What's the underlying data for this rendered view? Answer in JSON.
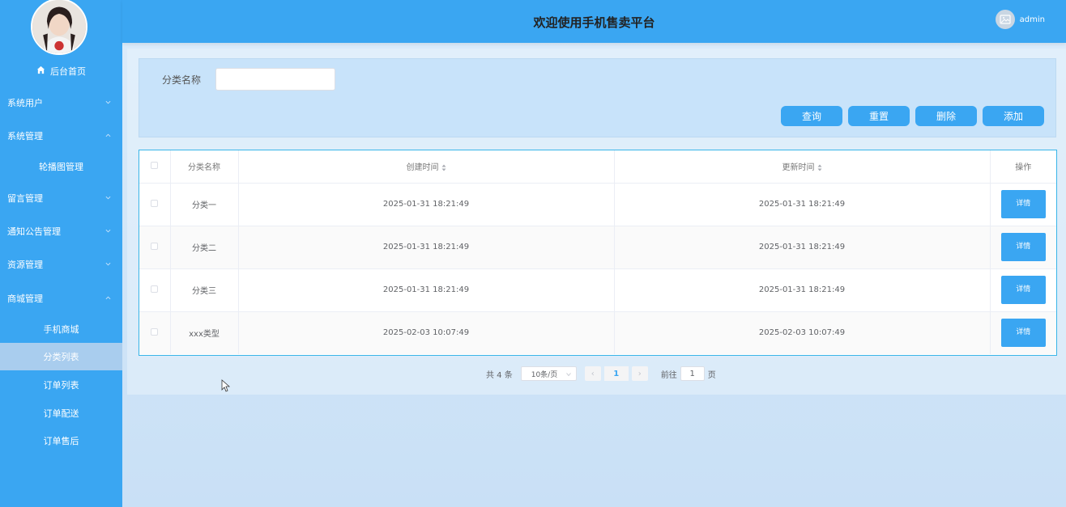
{
  "header": {
    "title": "欢迎使用手机售卖平台",
    "user": "admin"
  },
  "sidebar": {
    "home": "后台首页",
    "groups": [
      {
        "label": "系统用户",
        "expanded": false
      },
      {
        "label": "系统管理",
        "expanded": true,
        "items": [
          "轮播图管理"
        ]
      },
      {
        "label": "留言管理",
        "expanded": false
      },
      {
        "label": "通知公告管理",
        "expanded": false
      },
      {
        "label": "资源管理",
        "expanded": false
      },
      {
        "label": "商城管理",
        "expanded": true,
        "items": [
          "手机商城",
          "分类列表",
          "订单列表",
          "订单配送",
          "订单售后"
        ]
      }
    ],
    "active": "分类列表"
  },
  "search": {
    "label": "分类名称",
    "value": "",
    "buttons": {
      "query": "查询",
      "reset": "重置",
      "delete": "删除",
      "add": "添加"
    }
  },
  "table": {
    "columns": [
      "分类名称",
      "创建时间",
      "更新时间",
      "操作"
    ],
    "rows": [
      {
        "name": "分类一",
        "created": "2025-01-31 18:21:49",
        "updated": "2025-01-31 18:21:49",
        "action": "详情"
      },
      {
        "name": "分类二",
        "created": "2025-01-31 18:21:49",
        "updated": "2025-01-31 18:21:49",
        "action": "详情"
      },
      {
        "name": "分类三",
        "created": "2025-01-31 18:21:49",
        "updated": "2025-01-31 18:21:49",
        "action": "详情"
      },
      {
        "name": "xxx类型",
        "created": "2025-02-03 10:07:49",
        "updated": "2025-02-03 10:07:49",
        "action": "详情"
      }
    ]
  },
  "pagination": {
    "total": "共 4 条",
    "page_size": "10条/页",
    "prev": "‹",
    "current_page": "1",
    "next": "›",
    "goto_prefix": "前往",
    "goto_value": "1",
    "goto_suffix": "页"
  },
  "colors": {
    "accent": "#3aa6f2",
    "active_item": "#a9cdee",
    "table_border": "#39b5e8"
  }
}
